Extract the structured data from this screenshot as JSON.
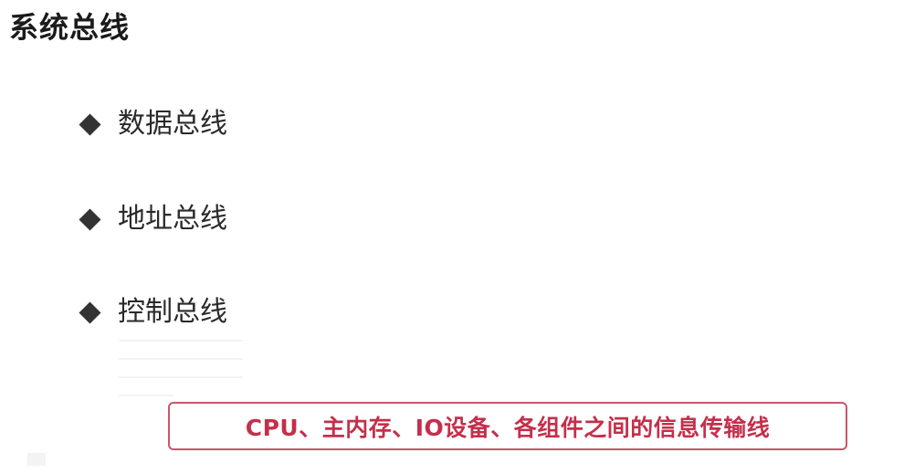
{
  "slide": {
    "title": "系统总线",
    "bullets": [
      {
        "label": "数据总线",
        "icon": "diamond-bullet-icon"
      },
      {
        "label": "地址总线",
        "icon": "diamond-bullet-icon"
      },
      {
        "label": "控制总线",
        "icon": "diamond-bullet-icon"
      }
    ],
    "note": "CPU、主内存、IO设备、各组件之间的信息传输线"
  },
  "colors": {
    "title": "#1b1b1b",
    "bullet_text": "#2a2a2a",
    "bullet_icon": "#333333",
    "note_border": "#c9566a",
    "note_text": "#c42f4b"
  }
}
